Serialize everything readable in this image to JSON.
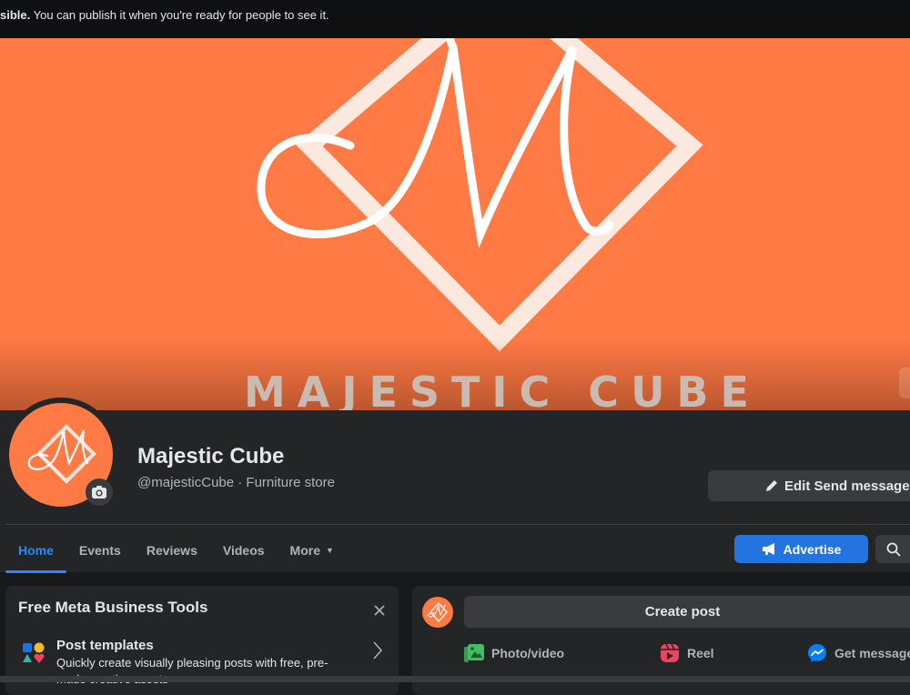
{
  "banner": {
    "bold_text": "sible.",
    "text": " You can publish it when you're ready for people to see it."
  },
  "cover": {
    "wordmark": "MAJESTIC CUBE",
    "background_color": "#ff7a45"
  },
  "profile": {
    "name": "Majestic Cube",
    "subtitle": "@majesticCube · Furniture store",
    "camera_icon": "camera-icon",
    "edit_button": "Edit Send message",
    "edit_icon": "pencil-icon"
  },
  "tabs": [
    {
      "label": "Home",
      "active": true
    },
    {
      "label": "Events",
      "active": false
    },
    {
      "label": "Reviews",
      "active": false
    },
    {
      "label": "Videos",
      "active": false
    },
    {
      "label": "More",
      "active": false
    }
  ],
  "toolbar": {
    "advertise_label": "Advertise",
    "advertise_icon": "megaphone-icon",
    "search_icon": "search-icon",
    "accent_color": "#2374e1"
  },
  "business_tools": {
    "title": "Free Meta Business Tools",
    "close_icon": "close-icon",
    "items": [
      {
        "title": "Post templates",
        "description": "Quickly create visually pleasing posts with free, pre-made creative assets"
      }
    ]
  },
  "composer": {
    "create_post_label": "Create post",
    "actions": [
      {
        "label": "Photo/video",
        "icon": "photo-video-icon",
        "color": "#45bd62"
      },
      {
        "label": "Reel",
        "icon": "reel-icon",
        "color": "#f3425f"
      },
      {
        "label": "Get messages",
        "icon": "messenger-icon",
        "color": "#0a7cff"
      }
    ]
  }
}
